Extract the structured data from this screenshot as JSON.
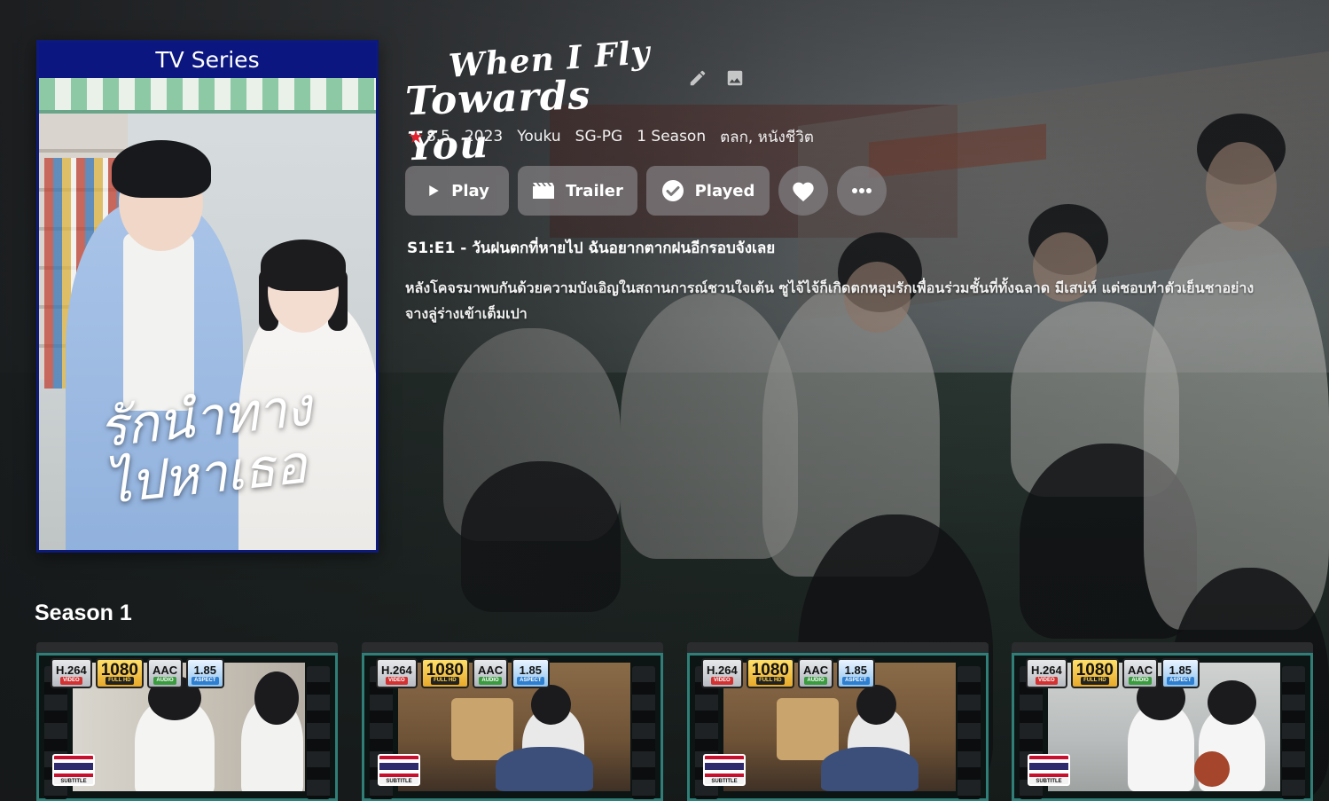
{
  "poster": {
    "banner": "TV Series",
    "art_title": "รักนำทางไปหาเธอ"
  },
  "show": {
    "logo_line1": "When I Fly",
    "logo_line2": "Towards You",
    "rating": "8.5",
    "year": "2023",
    "studio": "Youku",
    "content_rating": "SG-PG",
    "seasons": "1 Season",
    "genres": "ตลก, หนังชีวิต"
  },
  "actions": {
    "play": "Play",
    "trailer": "Trailer",
    "played": "Played"
  },
  "episode": {
    "title": "S1:E1 - วันฝนตกที่หายไป ฉันอยากตากฝนอีกรอบจังเลย",
    "overview": "หลังโคจรมาพบกันด้วยความบังเอิญในสถานการณ์ชวนใจเต้น ซูไจ้ไจ้ก็เกิดตกหลุมรักเพื่อนร่วมชั้นที่ทั้งฉลาด มีเสน่ห์ แต่ชอบทำตัวเย็นชาอย่างจางลู่ร่างเข้าเต็มเปา"
  },
  "season": {
    "title": "Season 1",
    "badges": {
      "codec": "H.264",
      "codec_sub": "VIDEO",
      "res": "1080",
      "res_sub": "FULL HD",
      "audio": "AAC",
      "audio_sub": "AUDIO",
      "aspect": "1.85",
      "aspect_sub": "ASPECT",
      "subtitle": "SUBTITLE"
    }
  },
  "colors": {
    "star": "#e3202c",
    "poster_border": "#0d1a7a",
    "film_frame": "#2f7f78"
  }
}
